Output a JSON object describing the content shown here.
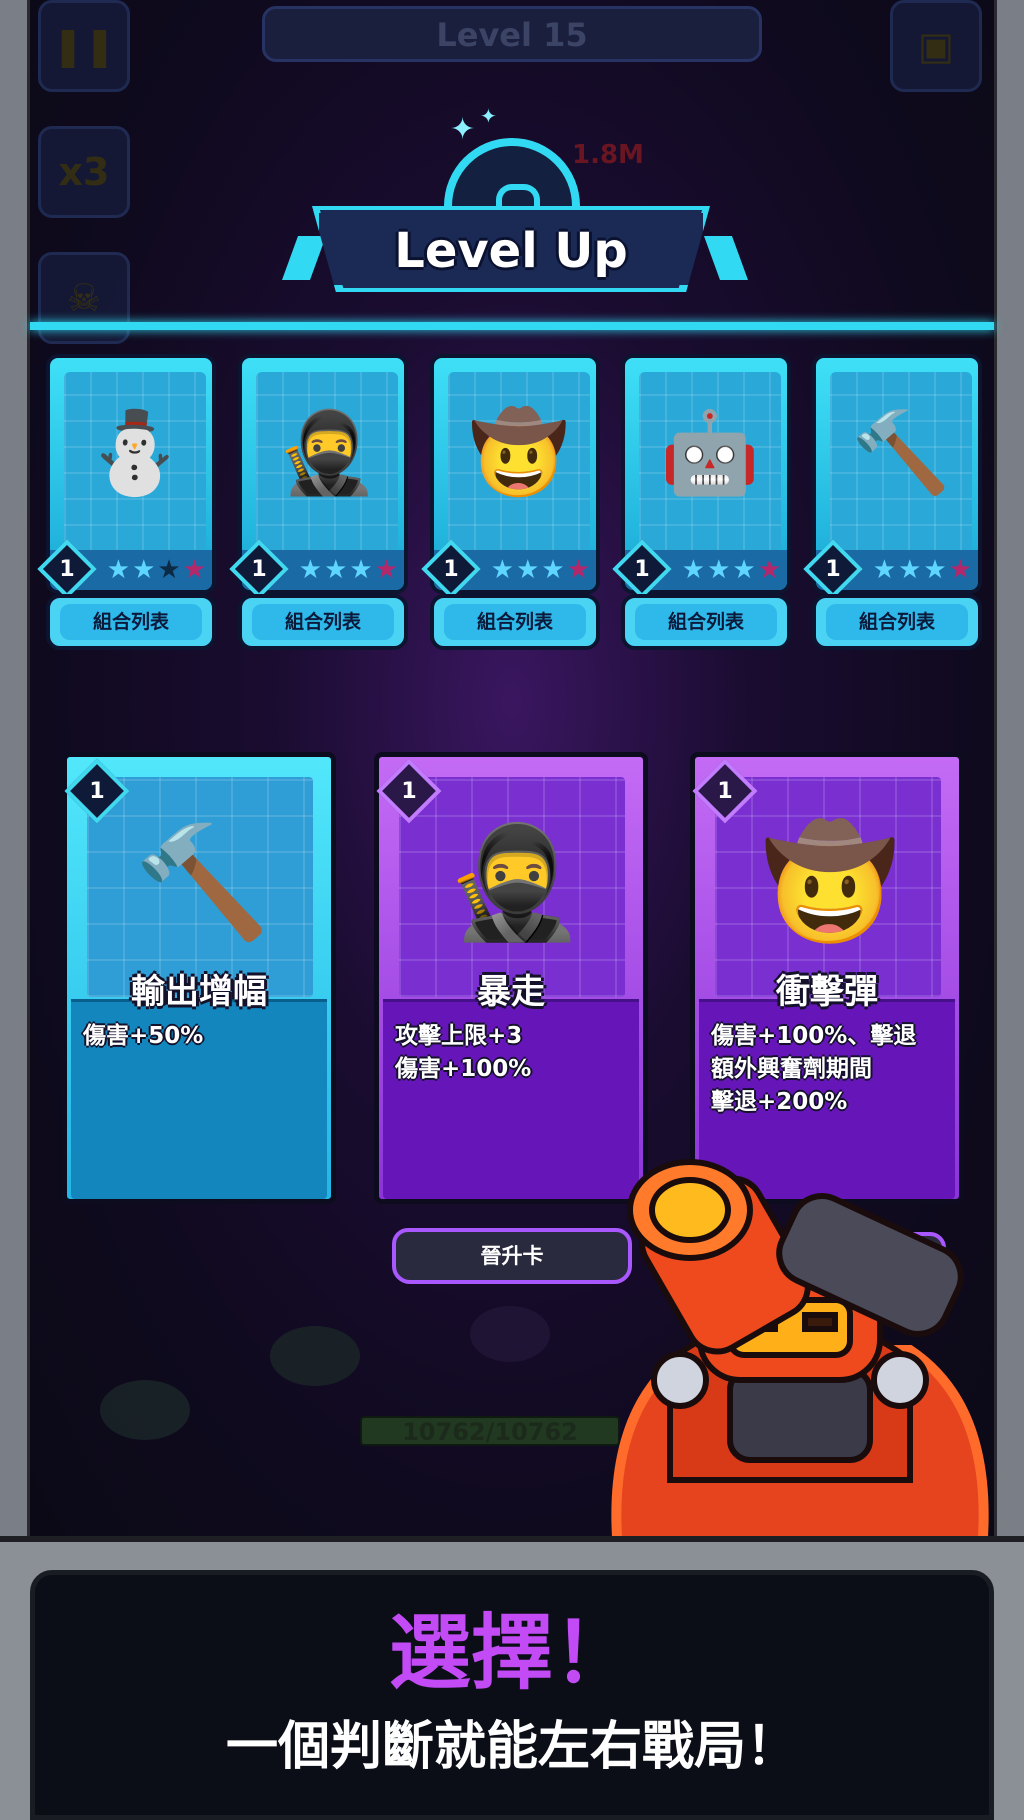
{
  "hud": {
    "level_label": "Level 15",
    "speed_label": "x3",
    "damage_popup": "1.8M"
  },
  "banner": {
    "title": "Level Up"
  },
  "heroes": [
    {
      "name": "snowman-hero",
      "level": "1",
      "stars_filled": 2,
      "stars_total": 4,
      "combo_label": "組合列表",
      "icon": "⛄"
    },
    {
      "name": "ninja-hero",
      "level": "1",
      "stars_filled": 3,
      "stars_total": 4,
      "combo_label": "組合列表",
      "icon": "🥷"
    },
    {
      "name": "cowboy-hero",
      "level": "1",
      "stars_filled": 3,
      "stars_total": 4,
      "combo_label": "組合列表",
      "icon": "🤠"
    },
    {
      "name": "cannon-robot-hero",
      "level": "1",
      "stars_filled": 3,
      "stars_total": 4,
      "combo_label": "組合列表",
      "icon": "🤖"
    },
    {
      "name": "hammer-knight-hero",
      "level": "1",
      "stars_filled": 3,
      "stars_total": 4,
      "combo_label": "組合列表",
      "icon": "🔨"
    }
  ],
  "choices": [
    {
      "title": "輸出增幅",
      "level": "1",
      "lines": [
        "傷害+50%"
      ],
      "style": "blue",
      "icon": "🔨"
    },
    {
      "title": "暴走",
      "level": "1",
      "lines": [
        "攻擊上限+3",
        "傷害+100%"
      ],
      "style": "purple",
      "icon": "🥷"
    },
    {
      "title": "衝擊彈",
      "level": "1",
      "lines": [
        "傷害+100%、擊退",
        "額外興奮劑期間",
        "擊退+200%"
      ],
      "style": "purple",
      "icon": "🤠"
    }
  ],
  "upgrade_button": "晉升卡",
  "hp_text": "10762/10762",
  "footer": {
    "title": "選擇！",
    "subtitle": "一個判斷就能左右戰局！"
  },
  "colors": {
    "accent_cyan": "#32d9f2",
    "accent_purple": "#c24bf5",
    "star_filled": "#5fd6ff",
    "star_special": "#b2286a"
  }
}
